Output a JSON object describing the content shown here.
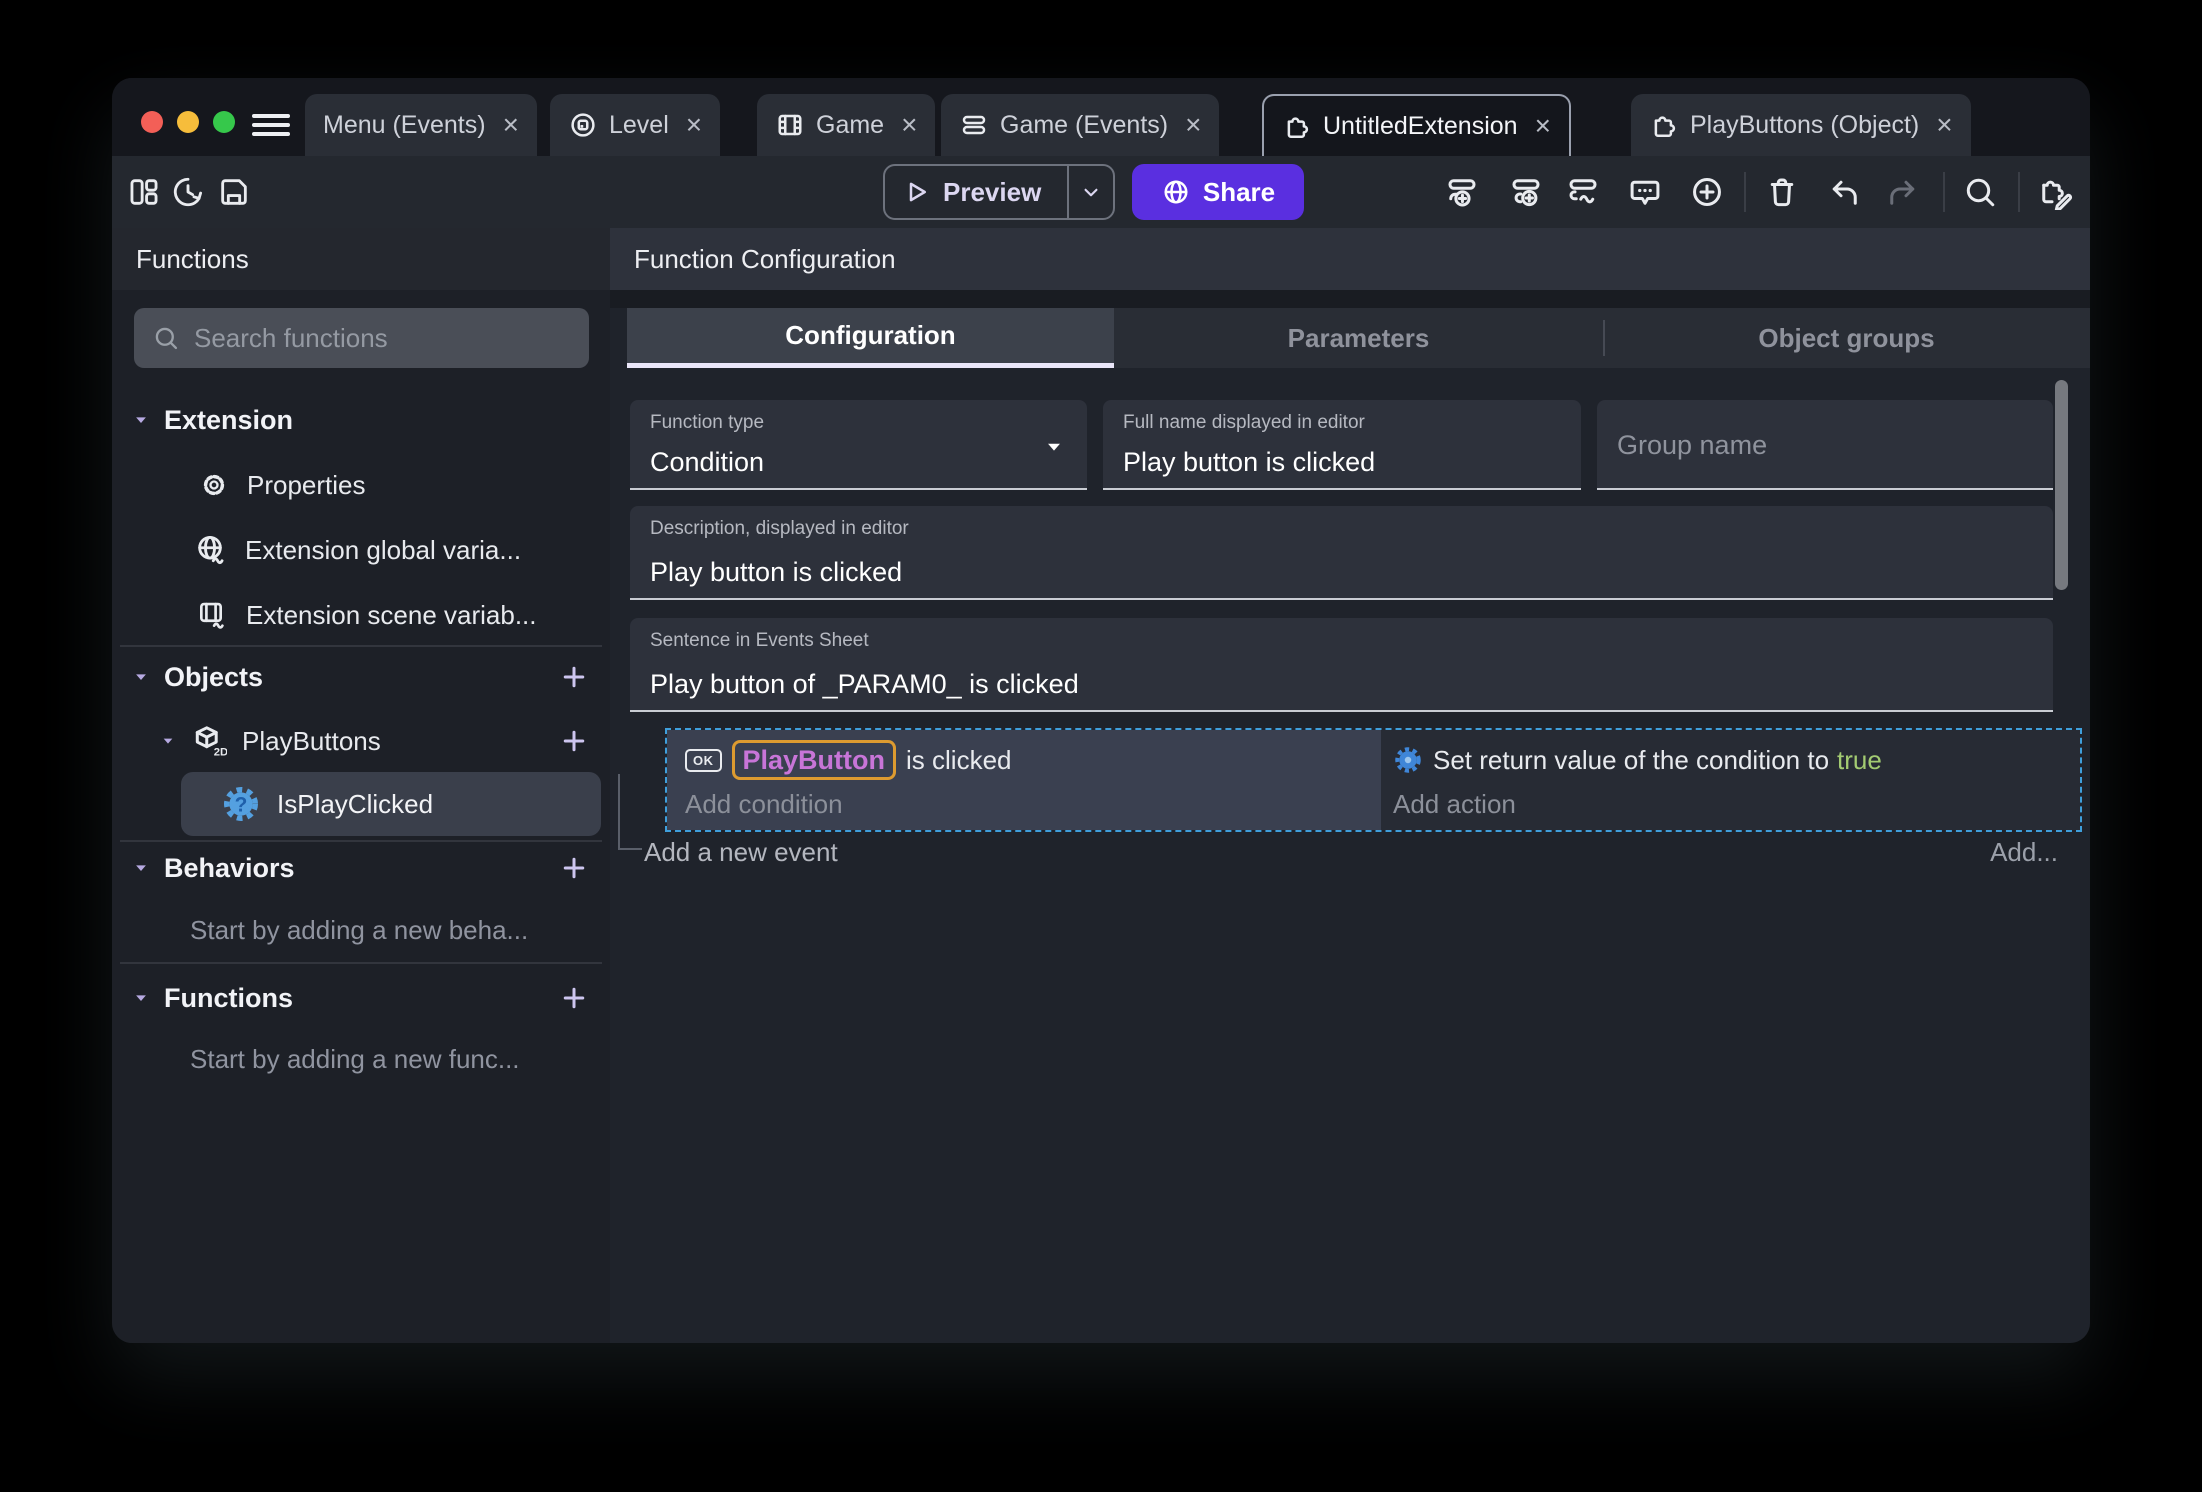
{
  "window": {
    "tab_close_glyph": "×",
    "tabs": [
      {
        "label": "Menu (Events)",
        "icon": "none"
      },
      {
        "label": "Level",
        "icon": "scene-icon"
      },
      {
        "label": "Game",
        "icon": "film-icon"
      },
      {
        "label": "Game (Events)",
        "icon": "events-icon"
      },
      {
        "label": "UntitledExtension",
        "icon": "puzzle-icon"
      },
      {
        "label": "PlayButtons (Object)",
        "icon": "puzzle-icon"
      }
    ]
  },
  "toolbar": {
    "preview_label": "Preview",
    "share_label": "Share"
  },
  "functions_panel": {
    "title": "Functions",
    "search_placeholder": "Search functions",
    "extension_section": {
      "label": "Extension",
      "items": [
        {
          "label": "Properties",
          "icon": "gear-icon"
        },
        {
          "label": "Extension global varia...",
          "icon": "globe-variable-icon"
        },
        {
          "label": "Extension scene variab...",
          "icon": "scene-variable-icon"
        }
      ]
    },
    "objects_section": {
      "label": "Objects",
      "object_label": "PlayButtons",
      "object_badge": "2D",
      "function_label": "IsPlayClicked"
    },
    "behaviors_section": {
      "label": "Behaviors",
      "empty_hint": "Start by adding a new beha..."
    },
    "functions_section": {
      "label": "Functions",
      "empty_hint": "Start by adding a new func..."
    }
  },
  "config_panel": {
    "title": "Function Configuration",
    "tabs": [
      {
        "label": "Configuration"
      },
      {
        "label": "Parameters"
      },
      {
        "label": "Object groups"
      }
    ],
    "fields": {
      "function_type": {
        "label": "Function type",
        "value": "Condition"
      },
      "full_name": {
        "label": "Full name displayed in editor",
        "value": "Play button is clicked"
      },
      "group_name": {
        "placeholder": "Group name"
      },
      "description": {
        "label": "Description, displayed in editor",
        "value": "Play button is clicked"
      },
      "sentence": {
        "label": "Sentence in Events Sheet",
        "value": "Play button of _PARAM0_ is clicked"
      }
    }
  },
  "events_sheet": {
    "condition": {
      "object_icon_label": "OK",
      "object_name": "PlayButton",
      "text": "is clicked",
      "add_label": "Add condition"
    },
    "action": {
      "text": "Set return value of the condition to",
      "value": "true",
      "add_label": "Add action"
    },
    "add_event_label": "Add a new event",
    "add_more_label": "Add..."
  },
  "colors": {
    "accent_purple": "#5a2fe0",
    "selection_dashed": "#3f9fdc",
    "object_chip_text": "#c875d8",
    "object_chip_border": "#dd9b30",
    "boolean_true": "#a3cb72",
    "lavender_accent": "#b7aae2",
    "traffic_close": "#f35f57",
    "traffic_minimize": "#f6bd3b",
    "traffic_zoom": "#36c84b"
  }
}
